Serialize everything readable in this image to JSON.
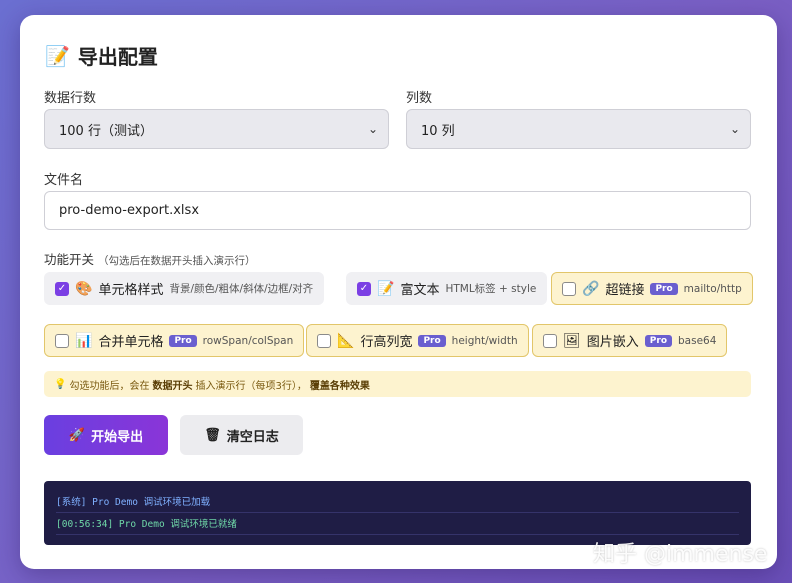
{
  "header": {
    "title": "导出配置",
    "icon": "memo-icon"
  },
  "rows": {
    "label": "数据行数",
    "value": "100 行（测试）"
  },
  "cols": {
    "label": "列数",
    "value": "10 列"
  },
  "file": {
    "label": "文件名",
    "value": "pro-demo-export.xlsx"
  },
  "features": {
    "title": "功能开关",
    "hint": "（勾选后在数据开头插入演示行）",
    "items": [
      {
        "label": "单元格样式",
        "sub": "背景/颜色/粗体/斜体/边框/对齐",
        "checked": true,
        "pro": false,
        "icon": "palette-icon"
      },
      {
        "label": "富文本",
        "sub": "HTML标签 + style",
        "checked": true,
        "pro": false,
        "icon": "memo-icon"
      },
      {
        "label": "超链接",
        "sub": "mailto/http",
        "checked": false,
        "pro": true,
        "icon": "link-icon"
      },
      {
        "label": "合并单元格",
        "sub": "rowSpan/colSpan",
        "checked": false,
        "pro": true,
        "icon": "chart-icon"
      },
      {
        "label": "行高列宽",
        "sub": "height/width",
        "checked": false,
        "pro": true,
        "icon": "ruler-icon"
      },
      {
        "label": "图片嵌入",
        "sub": "base64",
        "checked": false,
        "pro": true,
        "icon": "picture-icon"
      }
    ],
    "pro_badge": "Pro"
  },
  "tip": {
    "pre": "勾选功能后，会在",
    "strong1": "数据开头",
    "mid": "插入演示行（每项3行），",
    "strong2": "覆盖各种效果"
  },
  "buttons": {
    "start": "开始导出",
    "clear": "清空日志"
  },
  "log": [
    "[系统] Pro Demo 调试环境已加载",
    "[00:56:34] Pro Demo 调试环境已就绪"
  ],
  "watermark": "知乎 @immense",
  "colors": {
    "accent": "#7b3fe4",
    "pro_bg": "#fdf3cf",
    "log_bg": "#1f1d45"
  }
}
